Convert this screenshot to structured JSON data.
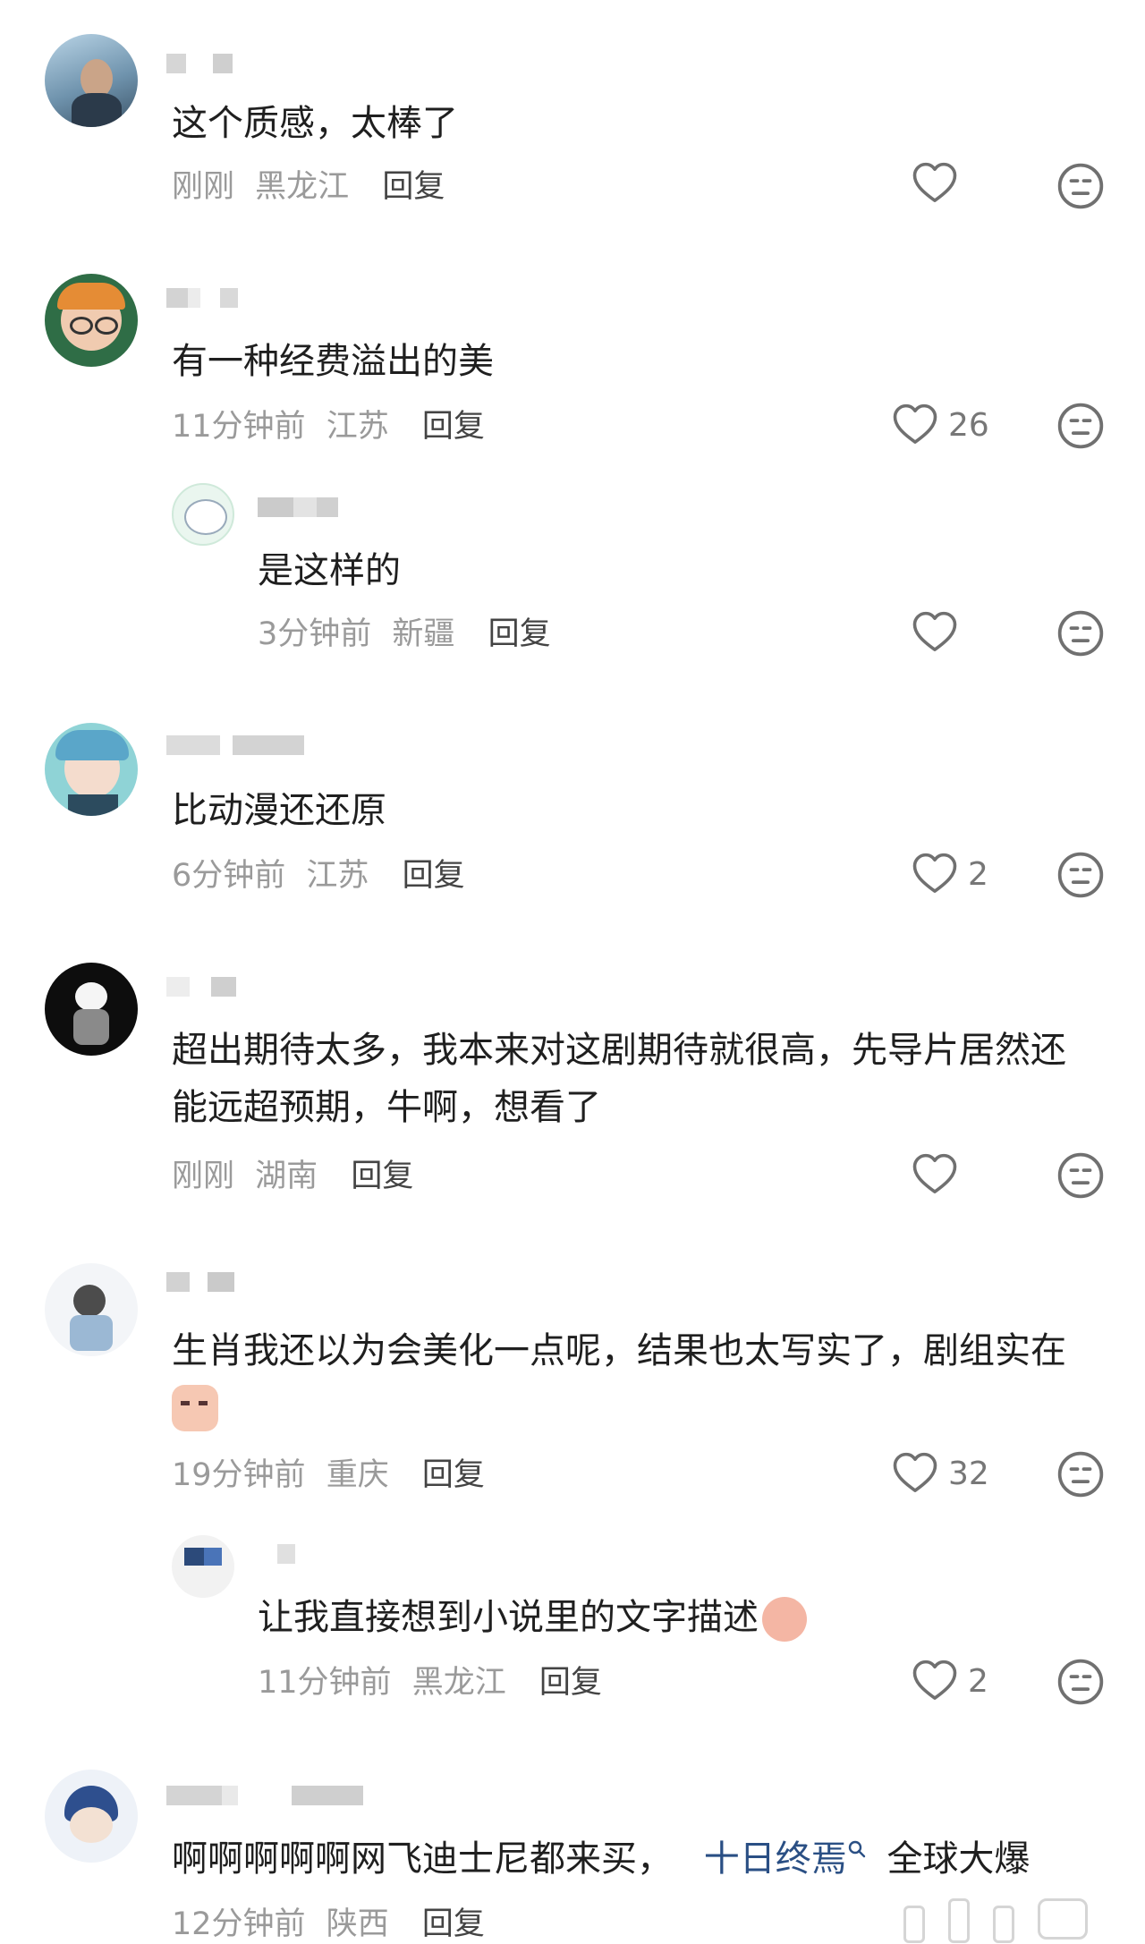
{
  "comments": [
    {
      "text": "这个质感，太棒了",
      "time": "刚刚",
      "region": "黑龙江",
      "reply": "回复",
      "likes": ""
    },
    {
      "text": "有一种经费溢出的美",
      "time": "11分钟前",
      "region": "江苏",
      "reply": "回复",
      "likes": "26"
    },
    {
      "text": "是这样的",
      "time": "3分钟前",
      "region": "新疆",
      "reply": "回复",
      "likes": ""
    },
    {
      "text": "比动漫还还原",
      "time": "6分钟前",
      "region": "江苏",
      "reply": "回复",
      "likes": "2"
    },
    {
      "text_line1": "超出期待太多，我本来对这剧期待就很高，先导片居然还",
      "text_line2": "能远超预期，牛啊，想看了",
      "time": "刚刚",
      "region": "湖南",
      "reply": "回复",
      "likes": ""
    },
    {
      "text_line1": "生肖我还以为会美化一点呢，结果也太写实了，剧组实在",
      "time": "19分钟前",
      "region": "重庆",
      "reply": "回复",
      "likes": "32"
    },
    {
      "text": "让我直接想到小说里的文字描述",
      "time": "11分钟前",
      "region": "黑龙江",
      "reply": "回复",
      "likes": "2"
    },
    {
      "text_prefix": "啊啊啊啊啊网飞迪士尼都来买，",
      "link": "十日终焉",
      "text_suffix": "全球大爆",
      "time": "12分钟前",
      "region": "陕西",
      "reply": "回复"
    }
  ],
  "icons": {
    "like": "heart-outline-icon",
    "dislike": "neutral-face-icon",
    "search_link": "search-icon"
  },
  "colors": {
    "meta": "#9a9a9a",
    "link": "#2a4f84",
    "text": "#1f1f1f"
  }
}
